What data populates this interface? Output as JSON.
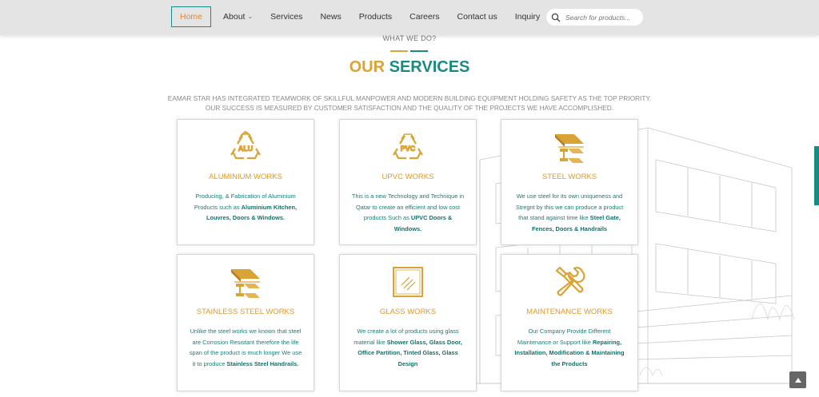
{
  "nav": {
    "items": [
      {
        "label": "Home",
        "active": true,
        "dropdown": false
      },
      {
        "label": "About",
        "active": false,
        "dropdown": true
      },
      {
        "label": "Services",
        "active": false,
        "dropdown": false
      },
      {
        "label": "News",
        "active": false,
        "dropdown": false
      },
      {
        "label": "Products",
        "active": false,
        "dropdown": false
      },
      {
        "label": "Careers",
        "active": false,
        "dropdown": false
      },
      {
        "label": "Contact us",
        "active": false,
        "dropdown": false
      },
      {
        "label": "Inquiry",
        "active": false,
        "dropdown": false
      }
    ],
    "search_placeholder": "Search for products..."
  },
  "section": {
    "kicker": "WHAT WE DO?",
    "title_part1": "OUR",
    "title_part2": "SERVICES",
    "intro_line1": "EAMAR STAR HAS INTEGRATED TEAMWORK OF SKILLFUL MANPOWER AND MODERN BUILDING EQUIPMENT HOLDING SAFETY AS THE TOP PRIORITY.",
    "intro_line2": "OUR SUCCESS IS MEASURED BY CUSTOMER SATISFACTION AND THE QUALITY OF THE PROJECTS WE HAVE ACCOMPLISHED."
  },
  "services": [
    {
      "title": "ALUMINIUM WORKS",
      "icon": "recycle-alu-icon",
      "icon_text": "ALU",
      "desc": "Producing, & Fabrication of Aluminium Products such as ",
      "desc_bold": "Aluminium Kitchen, Louvres, Doors & Windows."
    },
    {
      "title": "UPVC WORKS",
      "icon": "recycle-pvc-icon",
      "icon_text": "PVC",
      "desc": "This is a new Technology and Technique in Qatar to create an efficient and low cost products Such as ",
      "desc_bold": "UPVC Doors & Windows."
    },
    {
      "title": "STEEL WORKS",
      "icon": "steel-beam-icon",
      "desc": "We use steel for its own uniqueness and Stregnt by this we can produce a product that stand against time like ",
      "desc_bold": "Steel Gate, Fences, Doors & Handrails"
    },
    {
      "title": "STAINLESS STEEL WORKS",
      "icon": "steel-beam-icon",
      "desc": "Unlike the steel works we known that steel are Corrosion Resistant therefore the life span of the product is much longer We use it to produce ",
      "desc_bold": "Stainless Steel Handrails."
    },
    {
      "title": "GLASS WORKS",
      "icon": "glass-pane-icon",
      "desc": "We create a lot of products using glass material like ",
      "desc_bold": "Shower Glass, Glass Door, Office Partition, Tinted Glass, Glass Design"
    },
    {
      "title": "MAINTENANCE WORKS",
      "icon": "tools-icon",
      "desc": "Our Company Provide Different Maintenance or Support like ",
      "desc_bold": "Repairing, Installation, Modification & Maintaining the Products"
    }
  ],
  "colors": {
    "gold": "#d9a336",
    "orange": "#e0982c",
    "teal": "#1a8b84",
    "header_bg": "#e4e4e4"
  }
}
